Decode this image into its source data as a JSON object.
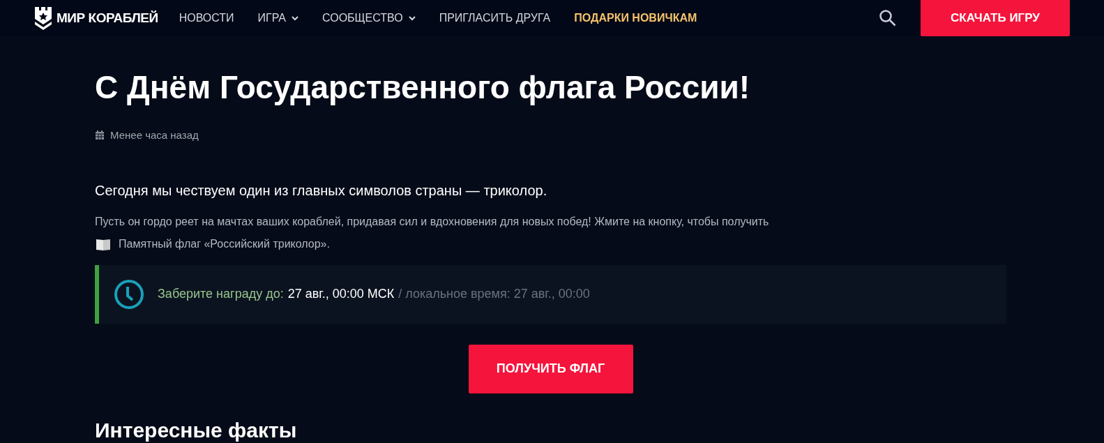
{
  "header": {
    "logo": "МИР КОРАБЛЕЙ",
    "nav": [
      {
        "label": "НОВОСТИ",
        "dropdown": false,
        "highlighted": false
      },
      {
        "label": "ИГРА",
        "dropdown": true,
        "highlighted": false
      },
      {
        "label": "СООБЩЕСТВО",
        "dropdown": true,
        "highlighted": false
      },
      {
        "label": "ПРИГЛАСИТЬ ДРУГА",
        "dropdown": false,
        "highlighted": false
      },
      {
        "label": "ПОДАРКИ НОВИЧКАМ",
        "dropdown": false,
        "highlighted": true
      }
    ],
    "download_button": "СКАЧАТЬ ИГРУ"
  },
  "article": {
    "title": "С Днём Государственного флага России!",
    "date": "Менее часа назад",
    "lead": "Сегодня мы чествуем один из главных символов страны — триколор.",
    "paragraph": "Пусть он гордо реет на мачтах ваших кораблей, придавая сил и вдохновения для новых побед! Жмите на кнопку, чтобы получить",
    "reward_item": "Памятный флаг «Российский триколор».",
    "deadline": {
      "label": "Заберите награду до:",
      "time": "27 авг., 00:00 МСК",
      "local": "/ локальное время: 27 авг., 00:00"
    },
    "claim_button": "ПОЛУЧИТЬ ФЛАГ",
    "section_heading": "Интересные факты"
  }
}
